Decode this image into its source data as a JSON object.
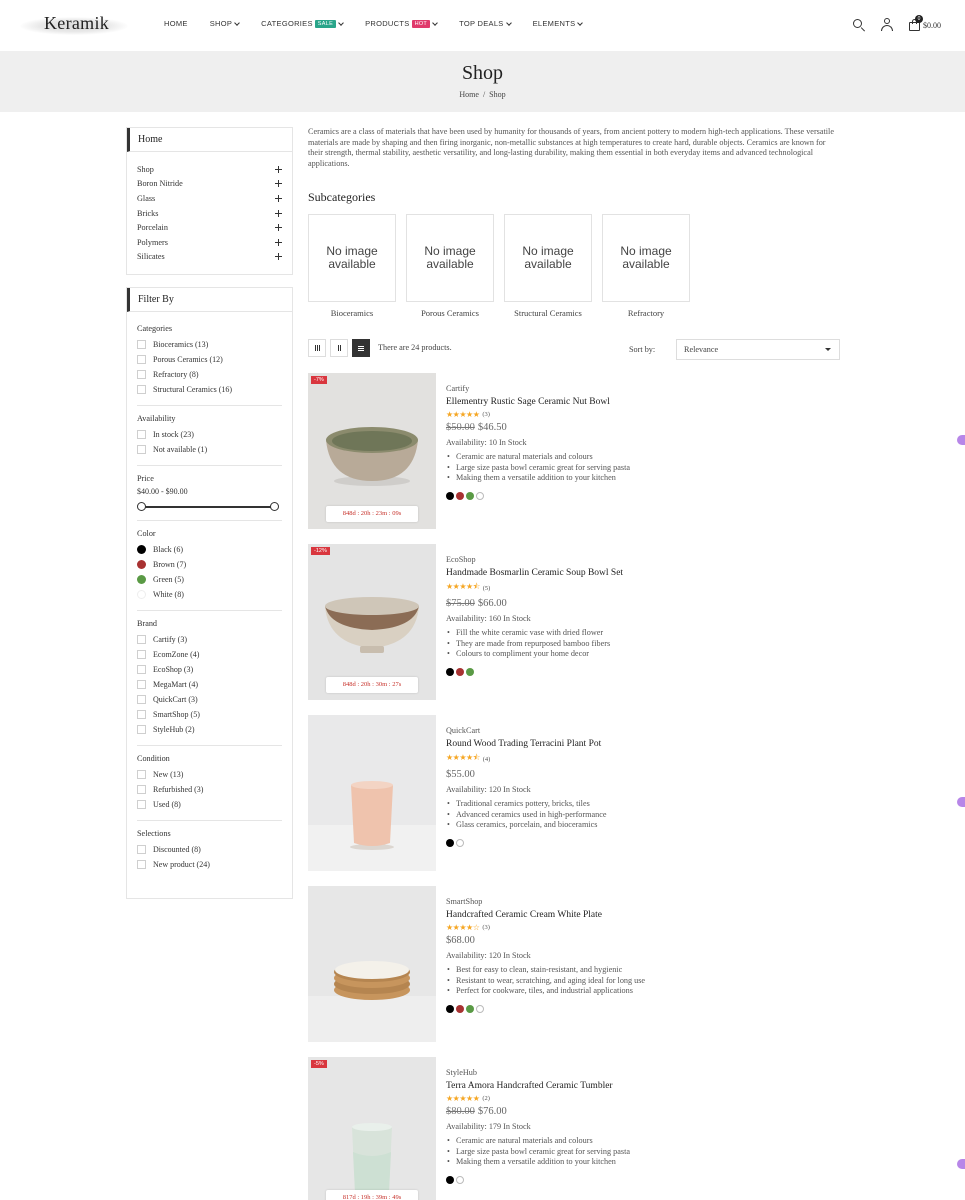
{
  "header": {
    "logo": "Keramik",
    "nav": [
      {
        "label": "HOME",
        "chevron": false,
        "badge": ""
      },
      {
        "label": "SHOP",
        "chevron": true,
        "badge": ""
      },
      {
        "label": "CATEGORIES",
        "chevron": true,
        "badge": "SALE",
        "badge_color": "#2aa58a"
      },
      {
        "label": "PRODUCTS",
        "chevron": true,
        "badge": "HOT",
        "badge_color": "#e03a6c"
      },
      {
        "label": "TOP DEALS",
        "chevron": true,
        "badge": ""
      },
      {
        "label": "ELEMENTS",
        "chevron": true,
        "badge": ""
      }
    ],
    "cart_count": "0",
    "cart_total": "$0.00",
    "icons": [
      "search-icon",
      "user-icon",
      "cart-icon"
    ]
  },
  "banner": {
    "title": "Shop",
    "breadcrumb": [
      "Home",
      "/",
      "Shop"
    ]
  },
  "sidebar": {
    "home_title": "Home",
    "categories": [
      "Shop",
      "Boron Nitride",
      "Glass",
      "Bricks",
      "Porcelain",
      "Polymers",
      "Silicates"
    ],
    "filter_title": "Filter By",
    "filters": {
      "categories": {
        "title": "Categories",
        "items": [
          "Bioceramics (13)",
          "Porous Ceramics (12)",
          "Refractory (8)",
          "Structural Ceramics (16)"
        ]
      },
      "availability": {
        "title": "Availability",
        "items": [
          "In stock (23)",
          "Not available (1)"
        ]
      },
      "price": {
        "title": "Price",
        "range": "$40.00 - $90.00"
      },
      "color": {
        "title": "Color",
        "items": [
          {
            "label": "Black (6)",
            "color": "#000000"
          },
          {
            "label": "Brown (7)",
            "color": "#a83232"
          },
          {
            "label": "Green (5)",
            "color": "#5a9a45"
          },
          {
            "label": "White (8)",
            "color": "#ffffff"
          }
        ]
      },
      "brand": {
        "title": "Brand",
        "items": [
          "Cartify (3)",
          "EcomZone (4)",
          "EcoShop (3)",
          "MegaMart (4)",
          "QuickCart (3)",
          "SmartShop (5)",
          "StyleHub (2)"
        ]
      },
      "condition": {
        "title": "Condition",
        "items": [
          "New (13)",
          "Refurbished (3)",
          "Used (8)"
        ]
      },
      "selections": {
        "title": "Selections",
        "items": [
          "Discounted (8)",
          "New product (24)"
        ]
      }
    }
  },
  "main": {
    "description": "Ceramics are a class of materials that have been used by humanity for thousands of years, from ancient pottery to modern high-tech applications. These versatile materials are made by shaping and then firing inorganic, non-metallic substances at high temperatures to create hard, durable objects. Ceramics are known for their strength, thermal stability, aesthetic versatility, and long-lasting durability, making them essential in both everyday items and advanced technological applications.",
    "subcategories_title": "Subcategories",
    "subcategories": [
      {
        "image_text": "No image available",
        "label": "Bioceramics"
      },
      {
        "image_text": "No image available",
        "label": "Porous Ceramics"
      },
      {
        "image_text": "No image available",
        "label": "Structural Ceramics"
      },
      {
        "image_text": "No image available",
        "label": "Refractory"
      }
    ],
    "toolbar": {
      "count_text": "There are 24 products.",
      "sort_label": "Sort by:",
      "sort_value": "Relevance"
    },
    "products": [
      {
        "discount": "-7%",
        "timer": "848d : 20h : 23m : 09s",
        "brand": "Cartify",
        "name": "Ellementry Rustic Sage Ceramic Nut Bowl",
        "stars": "★★★★★",
        "reviews": "(3)",
        "old_price": "$50.00",
        "price": "$46.50",
        "availability": "Availability: 10 In Stock",
        "features": [
          "Ceramic are natural materials and colours",
          "Large size pasta bowl ceramic great for serving pasta",
          "Making them a versatile addition to your kitchen"
        ],
        "colors": [
          "#000000",
          "#a83232",
          "#5a9a45",
          "#ffffff"
        ],
        "image": "green-bowl"
      },
      {
        "discount": "-12%",
        "timer": "848d : 20h : 30m : 27s",
        "brand": "EcoShop",
        "name": "Handmade Bosmarlin Ceramic Soup Bowl Set",
        "stars": "★★★★⯪",
        "reviews": "(5)",
        "old_price": "$75.00",
        "price": "$66.00",
        "availability": "Availability: 160 In Stock",
        "features": [
          "Fill the white ceramic vase with dried flower",
          "They are made from repurposed bamboo fibers",
          "Colours to compliment your home decor"
        ],
        "colors": [
          "#000000",
          "#a83232",
          "#5a9a45"
        ],
        "image": "speckled-bowl"
      },
      {
        "discount": "",
        "timer": "",
        "brand": "QuickCart",
        "name": "Round Wood Trading Terracini Plant Pot",
        "stars": "★★★★⯪",
        "reviews": "(4)",
        "old_price": "",
        "price": "$55.00",
        "availability": "Availability: 120 In Stock",
        "features": [
          "Traditional ceramics pottery, bricks, tiles",
          "Advanced ceramics used in high-performance",
          "Glass ceramics, porcelain, and bioceramics"
        ],
        "colors": [
          "#000000",
          "#ffffff"
        ],
        "image": "peach-pot"
      },
      {
        "discount": "",
        "timer": "",
        "brand": "SmartShop",
        "name": "Handcrafted Ceramic Cream White Plate",
        "stars": "★★★★☆",
        "reviews": "(3)",
        "old_price": "",
        "price": "$68.00",
        "availability": "Availability: 120 In Stock",
        "features": [
          "Best for easy to clean, stain-resistant, and hygienic",
          "Resistant to wear, scratching, and aging ideal for long use",
          "Perfect for cookware, tiles, and industrial applications"
        ],
        "colors": [
          "#000000",
          "#a83232",
          "#5a9a45",
          "#ffffff"
        ],
        "image": "plate-stack"
      },
      {
        "discount": "-5%",
        "timer": "817d : 19h : 39m : 49s",
        "brand": "StyleHub",
        "name": "Terra Amora Handcrafted Ceramic Tumbler",
        "stars": "★★★★★",
        "reviews": "(2)",
        "old_price": "$80.00",
        "price": "$76.00",
        "availability": "Availability: 179 In Stock",
        "features": [
          "Ceramic are natural materials and colours",
          "Large size pasta bowl ceramic great for serving pasta",
          "Making them a versatile addition to your kitchen"
        ],
        "colors": [
          "#000000",
          "#ffffff"
        ],
        "image": "mint-tumbler"
      }
    ]
  }
}
